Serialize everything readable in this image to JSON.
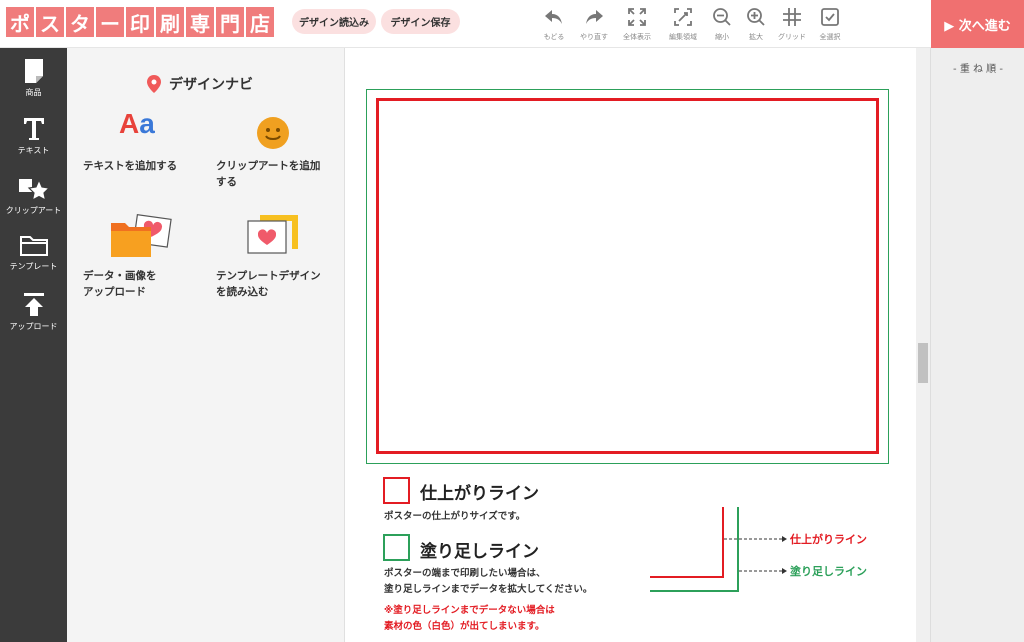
{
  "header": {
    "logo_chars": [
      "ポ",
      "ス",
      "タ",
      "ー",
      "印",
      "刷",
      "専",
      "門",
      "店"
    ],
    "buttons": {
      "load": "デザイン読込み",
      "save": "デザイン保存"
    },
    "tools": [
      {
        "label": "もどる",
        "icon": "undo-icon"
      },
      {
        "label": "やり直す",
        "icon": "redo-icon"
      },
      {
        "label": "全体表示",
        "icon": "fit-view-icon"
      },
      {
        "label": "編集領域",
        "icon": "edit-area-icon"
      },
      {
        "label": "縮小",
        "icon": "zoom-out-icon"
      },
      {
        "label": "拡大",
        "icon": "zoom-in-icon"
      },
      {
        "label": "グリッド",
        "icon": "grid-icon"
      },
      {
        "label": "全選択",
        "icon": "select-all-icon"
      }
    ],
    "next": "▶ 次へ進む"
  },
  "sidebar": {
    "items": [
      {
        "label": "商品",
        "icon": "product-icon"
      },
      {
        "label": "テキスト",
        "icon": "text-icon"
      },
      {
        "label": "クリップアート",
        "icon": "clipart-icon"
      },
      {
        "label": "テンプレート",
        "icon": "template-folder-icon"
      },
      {
        "label": "アップロード",
        "icon": "upload-icon"
      }
    ]
  },
  "navi": {
    "title": "デザインナビ",
    "items": [
      {
        "line1": "テキストを追加する",
        "line2": ""
      },
      {
        "line1": "クリップアートを追加",
        "line2": "する"
      },
      {
        "line1": "データ・画像を",
        "line2": "アップロード"
      },
      {
        "line1": "テンプレートデザイン",
        "line2": "を読み込む"
      }
    ],
    "text_icon": "Aa"
  },
  "legend": {
    "trim_title": "仕上がりライン",
    "trim_desc": "ポスターの仕上がりサイズです。",
    "bleed_title": "塗り足しライン",
    "bleed_desc1": "ポスターの端まで印刷したい場合は、",
    "bleed_desc2": "塗り足しラインまでデータを拡大してください。",
    "warn1": "※塗り足しラインまでデータない場合は",
    "warn2": "素材の色（白色）が出てしまいます。",
    "diag_trim": "仕上がりライン",
    "diag_bleed": "塗り足しライン"
  },
  "layers": {
    "title": "- 重 ね 順 -"
  },
  "colors": {
    "accent": "#f07070",
    "trim": "#e31c23",
    "bleed": "#2ca05a",
    "sidebar": "#3b3b3b"
  }
}
